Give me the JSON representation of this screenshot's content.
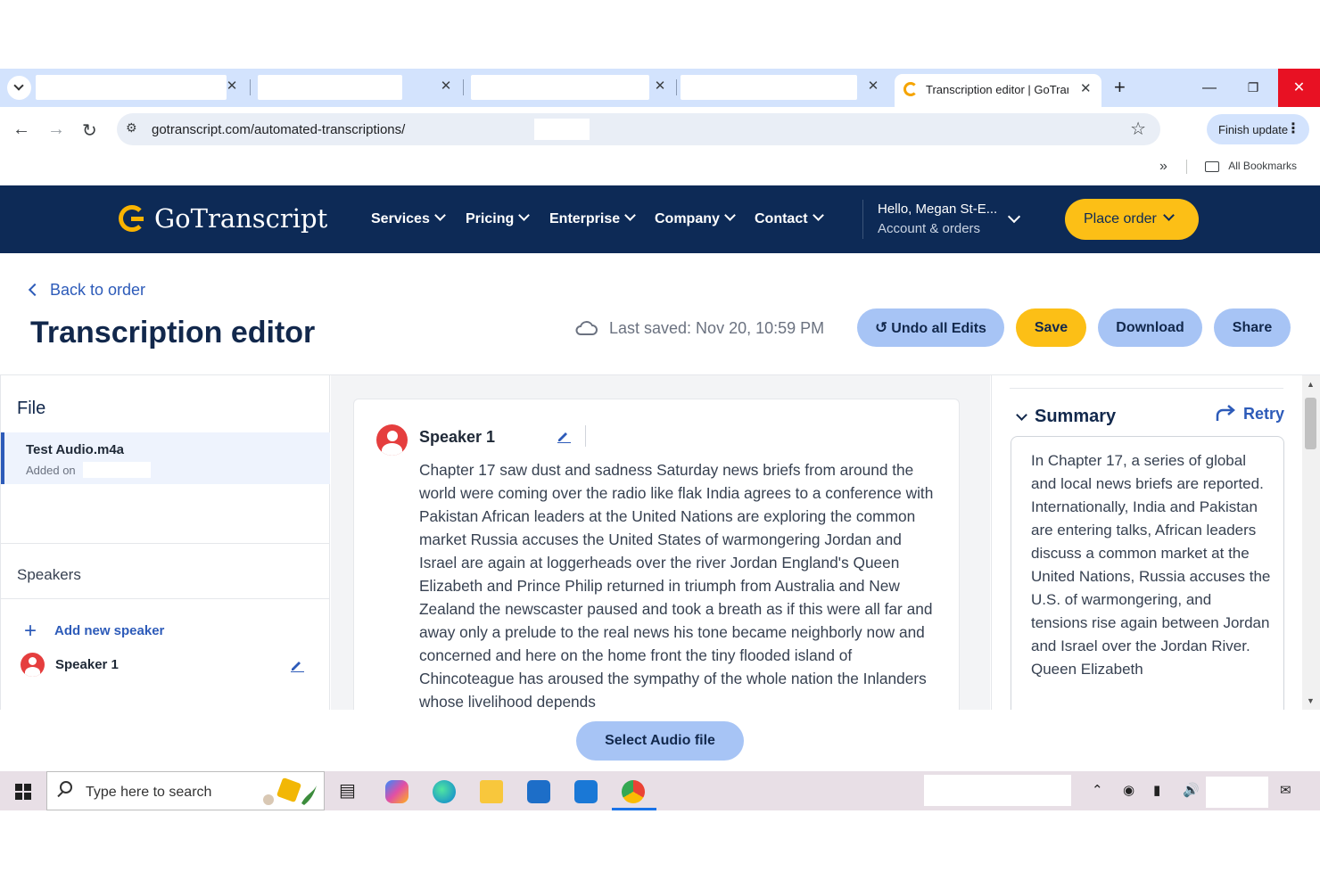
{
  "browser": {
    "active_tab_title": "Transcription editor | GoTranscript",
    "new_tab": "+",
    "url": "gotranscript.com/automated-transcriptions/",
    "finish_update": "Finish update",
    "all_bookmarks": "All Bookmarks",
    "overflow": "»"
  },
  "site_header": {
    "logo": "GoTranscript",
    "menu": [
      "Services",
      "Pricing",
      "Enterprise",
      "Company",
      "Contact"
    ],
    "hello": "Hello, Megan St-E...",
    "account": "Account & orders",
    "place_order": "Place order"
  },
  "page": {
    "back": "Back to order",
    "title": "Transcription editor",
    "last_saved": "Last saved: Nov 20, 10:59 PM",
    "actions": {
      "undo": "Undo all Edits",
      "save": "Save",
      "download": "Download",
      "share": "Share"
    }
  },
  "left_panel": {
    "file_heading": "File",
    "file_name": "Test Audio.m4a",
    "added_on": "Added on",
    "speakers_heading": "Speakers",
    "add_speaker": "Add new speaker",
    "speakers": [
      "Speaker 1"
    ]
  },
  "transcript": {
    "speaker": "Speaker 1",
    "text": "Chapter 17 saw dust and sadness Saturday news briefs from around the world were coming over the radio like flak India agrees to a conference with Pakistan African leaders at the United Nations are exploring the common market Russia accuses the United States of warmongering Jordan and Israel are again at loggerheads over the river Jordan England's Queen Elizabeth and Prince Philip returned in triumph from Australia and New Zealand the newscaster paused and took a breath as if this were all far and away only a prelude to the real news his tone became neighborly now and concerned and here on the home front the tiny flooded island of Chincoteague has aroused the sympathy of the whole nation the Inlanders whose livelihood depends"
  },
  "summary": {
    "heading": "Summary",
    "retry": "Retry",
    "text": "In Chapter 17, a series of global and local news briefs are reported. Internationally, India and Pakistan are entering talks, African leaders discuss a common market at the United Nations, Russia accuses the U.S. of warmongering, and tensions rise again between Jordan and Israel over the Jordan River. Queen Elizabeth"
  },
  "bottom": {
    "select_audio": "Select Audio file"
  },
  "taskbar": {
    "search_placeholder": "Type here to search"
  },
  "colors": {
    "header_bg": "#0d2a56",
    "accent_yellow": "#fcbf16",
    "pill_blue": "#a7c4f5",
    "link_blue": "#2d5bb9",
    "avatar_red": "#e53e3e"
  }
}
